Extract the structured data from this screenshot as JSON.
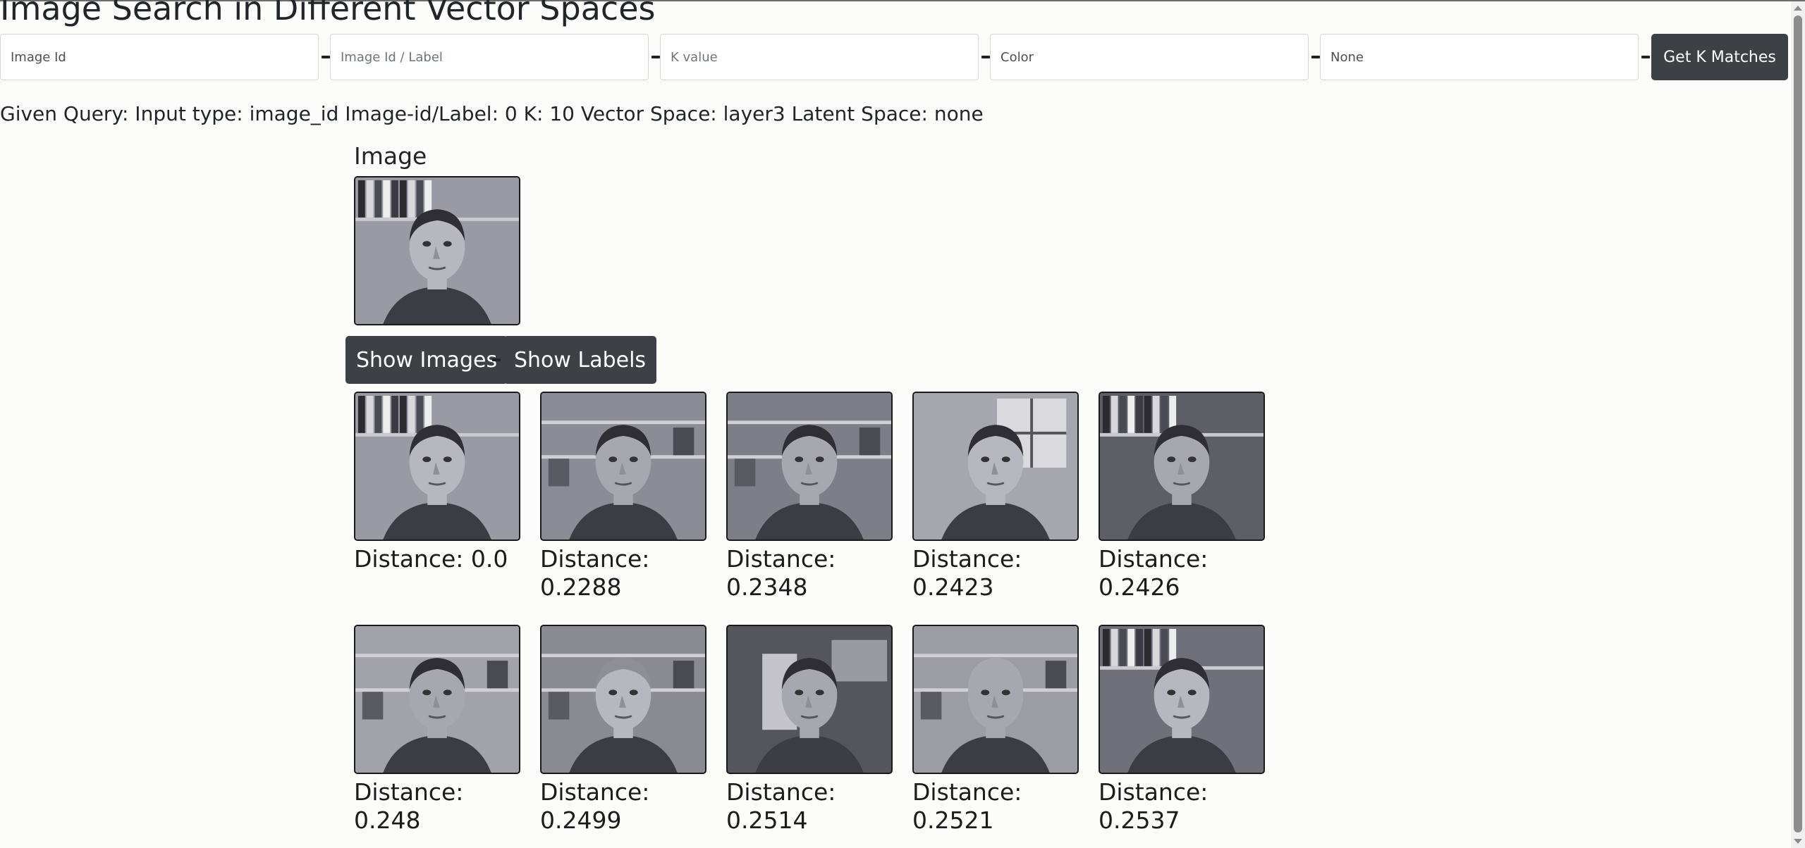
{
  "page": {
    "title": "Image Search in Different Vector Spaces"
  },
  "toolbar": {
    "input_type_value": "Image Id",
    "query_placeholder": "Image Id / Label",
    "k_placeholder": "K value",
    "vector_space_value": "Color",
    "latent_space_value": "None",
    "get_button_label": "Get K Matches"
  },
  "query": {
    "summary": "Given Query: Input type: image_id Image-id/Label: 0 K: 10 Vector Space: layer3 Latent Space: none"
  },
  "query_image": {
    "heading": "Image"
  },
  "buttons": {
    "show_images": "Show Images",
    "show_labels": "Show Labels"
  },
  "results": [
    {
      "distance_text": "Distance: 0.0",
      "background": "books"
    },
    {
      "distance_text": "Distance: 0.2288",
      "background": "shelf-computer"
    },
    {
      "distance_text": "Distance: 0.2348",
      "background": "office-wall"
    },
    {
      "distance_text": "Distance: 0.2423",
      "background": "window"
    },
    {
      "distance_text": "Distance: 0.2426",
      "background": "books-dark"
    },
    {
      "distance_text": "Distance: 0.248",
      "background": "shelf-plain"
    },
    {
      "distance_text": "Distance: 0.2499",
      "background": "shelf-books"
    },
    {
      "distance_text": "Distance: 0.2514",
      "background": "poster"
    },
    {
      "distance_text": "Distance: 0.2521",
      "background": "shelf-bald"
    },
    {
      "distance_text": "Distance: 0.2537",
      "background": "closeup"
    }
  ],
  "colors": {
    "button_bg": "#3d4146",
    "button_text": "#ffffff",
    "page_bg": "#fcfcfb"
  }
}
